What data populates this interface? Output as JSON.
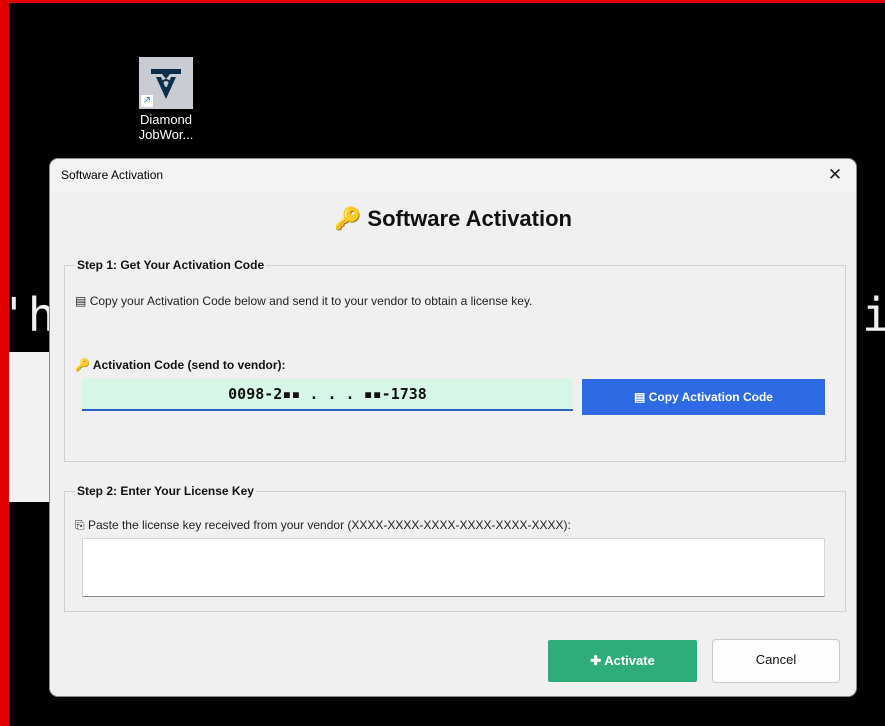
{
  "desktop": {
    "icon_label_line1": "Diamond",
    "icon_label_line2": "JobWor...",
    "bg_text_left": "'h",
    "bg_text_right": "i"
  },
  "dialog": {
    "window_title": "Software Activation",
    "close_glyph": "✕",
    "heading_icon": "🔑",
    "heading": "Software Activation",
    "step1": {
      "title": "Step 1: Get Your Activation Code",
      "info_icon": "▤",
      "info": "Copy your Activation Code below and send it to your vendor to obtain a license key.",
      "code_label_icon": "🔑",
      "code_label": "Activation Code (send to vendor):",
      "code_value": "0098-2▪▪ . . . ▪▪-1738",
      "copy_button_icon": "▤",
      "copy_button": "Copy Activation Code"
    },
    "step2": {
      "title": "Step 2: Enter Your License Key",
      "info_icon": "⎘",
      "info": "Paste the license key received from your vendor (XXXX-XXXX-XXXX-XXXX-XXXX-XXXX):",
      "license_value": ""
    },
    "activate_icon": "✚",
    "activate_button": "Activate",
    "cancel_button": "Cancel"
  },
  "colors": {
    "frame_border": "#e00000",
    "activation_field_bg": "#d6f7e6",
    "copy_button_bg": "#2d6ae3",
    "activate_button_bg": "#2ead7a"
  }
}
